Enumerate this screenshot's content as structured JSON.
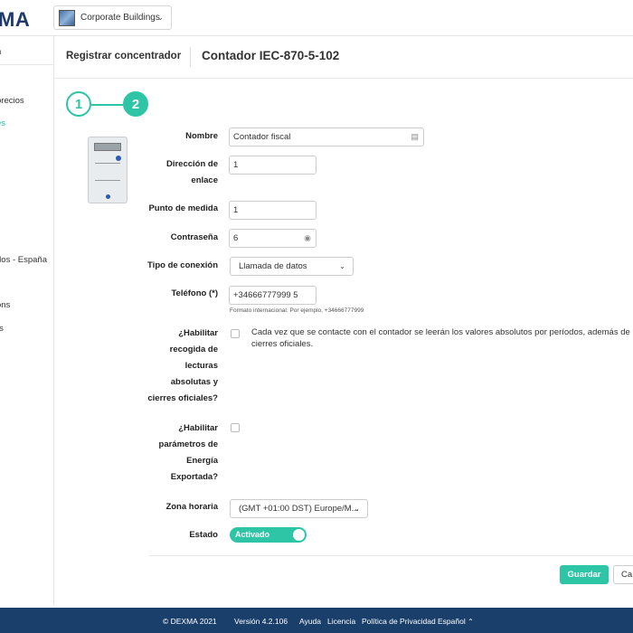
{
  "header": {
    "logo": "MA",
    "building": "Corporate Buildings"
  },
  "sidebar": {
    "items": [
      {
        "label": "n"
      },
      {
        "label": "precios"
      },
      {
        "label": "es"
      },
      {
        "label": "dos - España"
      },
      {
        "label": "ons"
      },
      {
        "label": "rs"
      }
    ]
  },
  "page": {
    "breadcrumb": "Registrar concentrador",
    "title": "Contador IEC-870-5-102"
  },
  "stepper": {
    "step1": "1",
    "step2": "2",
    "current_step": 2
  },
  "form": {
    "nombre": {
      "label": "Nombre",
      "value": "Contador fiscal"
    },
    "direccion": {
      "label_line1": "Dirección de",
      "label_line2": "enlace",
      "value": "1"
    },
    "punto": {
      "label": "Punto de medida",
      "value": "1"
    },
    "contrasena": {
      "label": "Contraseña",
      "value": "6"
    },
    "conexion": {
      "label": "Tipo de conexión",
      "value": "Llamada de datos"
    },
    "telefono": {
      "label": "Teléfono (*)",
      "value": "+34666777999 5",
      "help": "Formato internacional. Por ejemplo, +34666777999"
    },
    "lecturas": {
      "label_lines": [
        "¿Habilitar",
        "recogida de",
        "lecturas",
        "absolutas y",
        "cierres oficiales?"
      ],
      "description": "Cada vez que se contacte con el contador se leerán los valores absolutos por períodos, además de los cierres oficiales.",
      "checked": false
    },
    "energia": {
      "label_lines": [
        "¿Habilitar",
        "parámetros de",
        "Energía",
        "Exportada?"
      ],
      "checked": false
    },
    "zona": {
      "label": "Zona horaria",
      "value": "(GMT +01:00 DST) Europe/M..."
    },
    "estado": {
      "label": "Estado",
      "value": "Activado",
      "on": true
    }
  },
  "actions": {
    "save": "Guardar",
    "cancel": "Ca"
  },
  "footer": {
    "copyright": "© DEXMA 2021",
    "version": "Versión 4.2.106",
    "help": "Ayuda",
    "license": "Licencia",
    "privacy": "Política de Privacidad",
    "language": "Español"
  },
  "colors": {
    "accent": "#2ec4a6",
    "brand": "#1d3a6b",
    "footer": "#1a3f6b"
  }
}
